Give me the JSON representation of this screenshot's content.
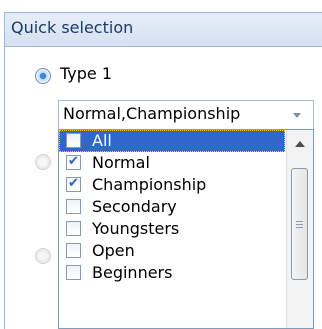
{
  "panel": {
    "title": "Quick selection"
  },
  "radio_options": [
    {
      "label": "Type 1",
      "checked": true
    },
    {
      "label": "",
      "checked": false
    },
    {
      "label": "",
      "checked": false
    }
  ],
  "combo": {
    "value": "Normal,Championship",
    "icon": "chevron-down-icon"
  },
  "dropdown": {
    "items": [
      {
        "label": "All",
        "checked": false,
        "selected": true
      },
      {
        "label": "Normal",
        "checked": true,
        "selected": false
      },
      {
        "label": "Championship",
        "checked": true,
        "selected": false
      },
      {
        "label": "Secondary",
        "checked": false,
        "selected": false
      },
      {
        "label": "Youngsters",
        "checked": false,
        "selected": false
      },
      {
        "label": "Open",
        "checked": false,
        "selected": false
      },
      {
        "label": "Beginners",
        "checked": false,
        "selected": false
      }
    ]
  },
  "colors": {
    "selection": "#3167c8",
    "panel_border": "#9cb8da",
    "header_text": "#1e3a66",
    "checkmark": "#2b63c6"
  }
}
